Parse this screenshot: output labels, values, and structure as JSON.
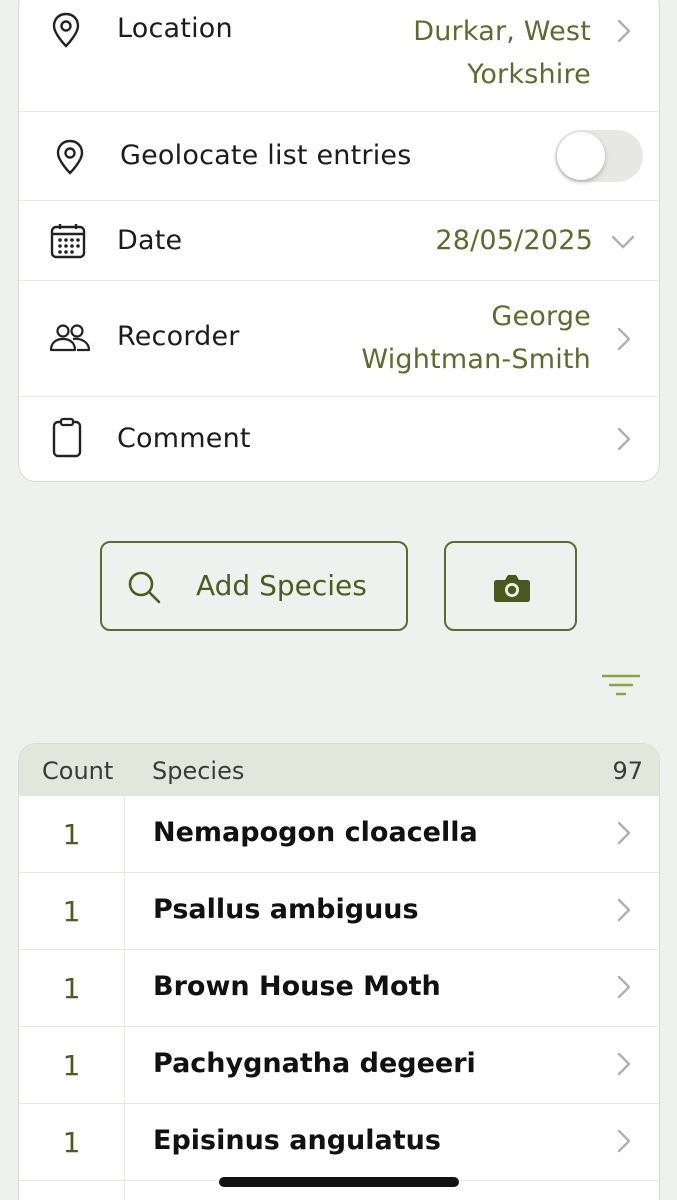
{
  "details": {
    "location": {
      "label": "Location",
      "value_line1": "Durkar, West",
      "value_line2": "Yorkshire"
    },
    "geolocate": {
      "label": "Geolocate list entries",
      "enabled": false
    },
    "date": {
      "label": "Date",
      "value": "28/05/2025"
    },
    "recorder": {
      "label": "Recorder",
      "value_line1": "George",
      "value_line2": "Wightman-Smith"
    },
    "comment": {
      "label": "Comment"
    }
  },
  "actions": {
    "add_species_label": "Add Species"
  },
  "species_list": {
    "headers": {
      "count": "Count",
      "species": "Species",
      "total": "97"
    },
    "rows": [
      {
        "count": "1",
        "name": "Nemapogon cloacella"
      },
      {
        "count": "1",
        "name": "Psallus ambiguus"
      },
      {
        "count": "1",
        "name": "Brown House Moth"
      },
      {
        "count": "1",
        "name": "Pachygnatha degeeri"
      },
      {
        "count": "1",
        "name": "Episinus angulatus"
      }
    ]
  },
  "colors": {
    "accent": "#5e6b2b",
    "background": "#eff1ee",
    "header_bg": "#e3e6da"
  },
  "icons": [
    "map-pin-icon",
    "calendar-icon",
    "people-icon",
    "clipboard-icon",
    "chevron-right-icon",
    "chevron-down-icon",
    "search-icon",
    "camera-icon",
    "filter-icon"
  ]
}
